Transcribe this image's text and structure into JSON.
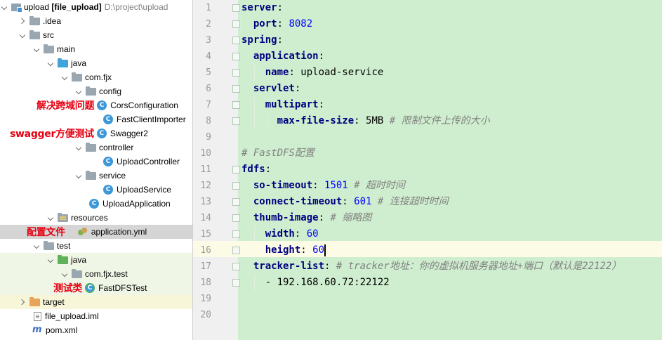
{
  "tree": {
    "root": {
      "name": "upload",
      "module": "[file_upload]",
      "path": "D:\\project\\upload"
    },
    "items": {
      "idea": ".idea",
      "src": "src",
      "main": "main",
      "java": "java",
      "pkg": "com.fjx",
      "config": "config",
      "cors": "CorsConfiguration",
      "fastclient": "FastClientImporter",
      "swagger": "Swagger2",
      "controller": "controller",
      "uploadcontroller": "UploadController",
      "service": "service",
      "uploadservice": "UploadService",
      "uploadapp": "UploadApplication",
      "resources": "resources",
      "appyml": "application.yml",
      "test": "test",
      "testjava": "java",
      "testpkg": "com.fjx.test",
      "fastdfstest": "FastDFSTest",
      "target": "target",
      "iml": "file_upload.iml",
      "pom": "pom.xml"
    },
    "annotations": {
      "cors": "解决跨域问题",
      "swagger": "swagger方便测试",
      "config_file": "配置文件",
      "test_class": "测试类"
    },
    "class_icon_letter": "C"
  },
  "editor": {
    "line_numbers": [
      "1",
      "2",
      "3",
      "4",
      "5",
      "6",
      "7",
      "8",
      "9",
      "10",
      "11",
      "12",
      "13",
      "14",
      "15",
      "16",
      "17",
      "18",
      "19",
      "20"
    ],
    "lines": {
      "l1": {
        "key": "server",
        "colon": ":"
      },
      "l2": {
        "indent": "  ",
        "key": "port",
        "colon": ": ",
        "value": "8082"
      },
      "l3": {
        "key": "spring",
        "colon": ":"
      },
      "l4": {
        "indent": "  ",
        "key": "application",
        "colon": ":"
      },
      "l5": {
        "indent": "    ",
        "key": "name",
        "colon": ": ",
        "value": "upload-service"
      },
      "l6": {
        "indent": "  ",
        "key": "servlet",
        "colon": ":"
      },
      "l7": {
        "indent": "    ",
        "key": "multipart",
        "colon": ":"
      },
      "l8": {
        "indent": "      ",
        "key": "max-file-size",
        "colon": ": ",
        "value": "5MB ",
        "comment": "# 限制文件上传的大小"
      },
      "l10": {
        "comment": "# FastDFS配置"
      },
      "l11": {
        "key": "fdfs",
        "colon": ":"
      },
      "l12": {
        "indent": "  ",
        "key": "so-timeout",
        "colon": ": ",
        "value": "1501",
        "comment": " # 超时时间"
      },
      "l13": {
        "indent": "  ",
        "key": "connect-timeout",
        "colon": ": ",
        "value": "601",
        "comment": " # 连接超时时间"
      },
      "l14": {
        "indent": "  ",
        "key": "thumb-image",
        "colon": ": ",
        "comment": "# 缩略图"
      },
      "l15": {
        "indent": "    ",
        "key": "width",
        "colon": ": ",
        "value": "60"
      },
      "l16": {
        "indent": "    ",
        "key": "height",
        "colon": ": ",
        "value": "60"
      },
      "l17": {
        "indent": "  ",
        "key": "tracker-list",
        "colon": ": ",
        "comment": "# tracker地址：你的虚拟机服务器地址+端口（默认是22122）"
      },
      "l18": {
        "indent": "    ",
        "value": "- 192.168.60.72:22122"
      }
    },
    "colors": {
      "background": "#cfeecf",
      "key": "#000080",
      "number": "#0000ff",
      "comment": "#808080",
      "current_line": "#fcfbe6"
    }
  }
}
